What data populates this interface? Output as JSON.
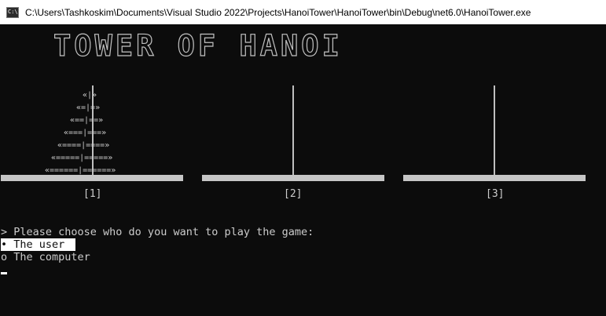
{
  "window": {
    "title": "C:\\Users\\Tashkoskim\\Documents\\Visual Studio 2022\\Projects\\HanoiTower\\HanoiTower\\bin\\Debug\\net6.0\\HanoiTower.exe",
    "icon": "console-app-icon"
  },
  "banner": {
    "text": "TOWER OF HANOI"
  },
  "pegs": [
    {
      "label": "[1]",
      "disks": [
        "«|»",
        "«=|=»",
        "«==|==»",
        "«===|===»",
        "«====|====»",
        "«=====|=====»",
        "«======|======»"
      ]
    },
    {
      "label": "[2]",
      "disks": []
    },
    {
      "label": "[3]",
      "disks": []
    }
  ],
  "prompt": {
    "question": "> Please choose who do you want to play the game:",
    "options": [
      {
        "marker": "•",
        "label": "The user",
        "selected": true
      },
      {
        "marker": "o",
        "label": "The computer",
        "selected": false
      }
    ]
  },
  "colors": {
    "console_bg": "#0c0c0c",
    "console_text": "#cccccc",
    "highlight_bg": "#ffffff"
  }
}
